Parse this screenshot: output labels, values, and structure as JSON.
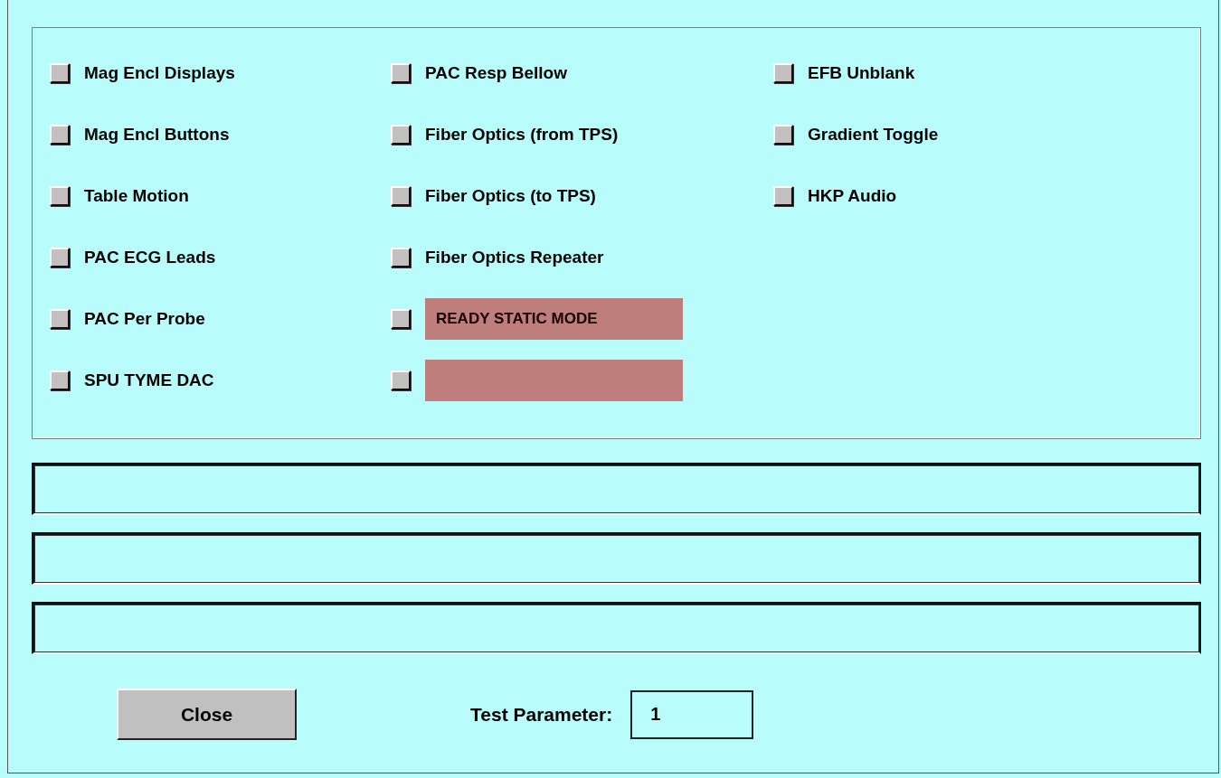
{
  "columns": [
    {
      "items": [
        {
          "kind": "label",
          "text": "Mag Encl Displays"
        },
        {
          "kind": "label",
          "text": "Mag Encl Buttons"
        },
        {
          "kind": "label",
          "text": "Table Motion"
        },
        {
          "kind": "label",
          "text": "PAC ECG Leads"
        },
        {
          "kind": "label",
          "text": "PAC Per Probe"
        },
        {
          "kind": "label",
          "text": "SPU TYME DAC"
        }
      ]
    },
    {
      "items": [
        {
          "kind": "label",
          "text": "PAC Resp Bellow"
        },
        {
          "kind": "label",
          "text": "Fiber Optics (from TPS)"
        },
        {
          "kind": "label",
          "text": "Fiber Optics (to TPS)"
        },
        {
          "kind": "label",
          "text": "Fiber Optics Repeater"
        },
        {
          "kind": "status",
          "text": "READY STATIC MODE"
        },
        {
          "kind": "status"
        }
      ]
    },
    {
      "items": [
        {
          "kind": "label",
          "text": "EFB Unblank"
        },
        {
          "kind": "label",
          "text": "Gradient Toggle"
        },
        {
          "kind": "label",
          "text": "HKP Audio"
        }
      ]
    }
  ],
  "message_fields": [
    {
      "kind": "field"
    },
    {
      "kind": "field"
    },
    {
      "kind": "field"
    }
  ],
  "close_button": "Close",
  "test_parameter": {
    "label": "Test Parameter:",
    "value": "1"
  }
}
